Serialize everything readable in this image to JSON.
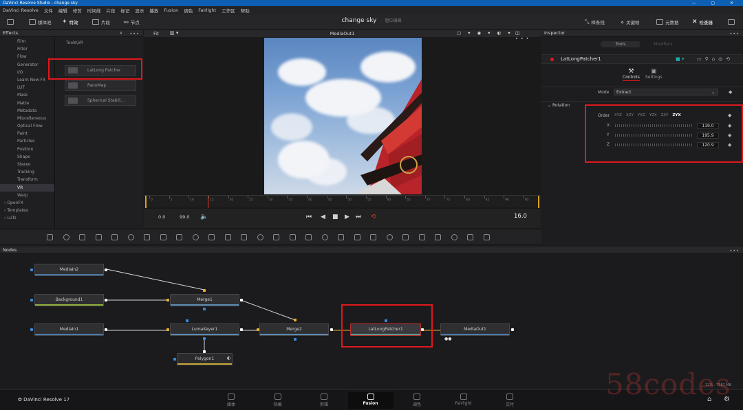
{
  "window": {
    "title": "DaVinci Resolve Studio - change sky"
  },
  "menu": [
    "DaVinci Resolve",
    "文件",
    "编辑",
    "修剪",
    "时间线",
    "片段",
    "标记",
    "显示",
    "播放",
    "Fusion",
    "调色",
    "Fairlight",
    "工作区",
    "帮助"
  ],
  "toolbar": {
    "media_pool": "媒体池",
    "effects": "特效",
    "clips": "片段",
    "nodes": "节点",
    "project_title": "change sky",
    "project_sub": "暂位编辑",
    "spline": "样条线",
    "keyframes": "关键帧",
    "metadata": "元数据",
    "inspector": "检查器"
  },
  "effects": {
    "title": "Effects",
    "tools_heading": "Tools\\VR",
    "items": [
      "Film",
      "Filter",
      "Flow",
      "Generator",
      "I/O",
      "Learn Now FX",
      "LUT",
      "Mask",
      "Matte",
      "Metadata",
      "Miscellaneous",
      "Optical Flow",
      "Paint",
      "Particles",
      "Position",
      "Shape",
      "Stereo",
      "Tracking",
      "Transform",
      "VR",
      "Warp"
    ],
    "selected": "VR",
    "groups": [
      "OpenFX",
      "Templates",
      "LUTs"
    ],
    "tools": [
      "LatLong Patcher",
      "PanoMap",
      "Spherical Stabili..."
    ]
  },
  "viewer": {
    "title": "MediaOut1",
    "zoom": "Fit",
    "start": "0.0",
    "end": "99.0",
    "current": "16.0",
    "ticks": [
      "0",
      "5",
      "10",
      "15",
      "20",
      "25",
      "30",
      "35",
      "40",
      "45",
      "50",
      "55",
      "60",
      "65",
      "70",
      "75",
      "80",
      "85",
      "90",
      "95"
    ]
  },
  "inspector": {
    "title": "Inspector",
    "tab_tools": "Tools",
    "tab_modifiers": "Modifiers",
    "node_name": "LatLongPatcher1",
    "controls": "Controls",
    "settings": "Settings",
    "mode_label": "Mode",
    "mode_value": "Extract",
    "rotation_label": "Rotation",
    "order_label": "Order",
    "orders": [
      "XYZ",
      "XZY",
      "YXZ",
      "YZX",
      "ZXY",
      "ZYX"
    ],
    "active_order": "ZYX",
    "axes": [
      {
        "label": "X",
        "value": "119.0"
      },
      {
        "label": "Y",
        "value": "195.9"
      },
      {
        "label": "Z",
        "value": "120.9"
      }
    ]
  },
  "nodes": {
    "title": "Nodes",
    "list": {
      "mediain2": "MediaIn2",
      "background1": "Background1",
      "mediain1": "MediaIn1",
      "merge1": "Merge1",
      "lumakeyer1": "LumaKeyer1",
      "polygon1": "Polygon1",
      "merge2": "Merge2",
      "latlong": "LatLongPatcher1",
      "mediaout1": "MediaOut1"
    },
    "status": "12% - 7581 MB"
  },
  "footer": {
    "app": "DaVinci Resolve 17",
    "pages": [
      "媒体",
      "快编",
      "剪辑",
      "Fusion",
      "调色",
      "Fairlight",
      "交付"
    ],
    "active": "Fusion"
  },
  "watermark": "58codes",
  "colors": {
    "accent_red": "#e0181c",
    "titlebar": "#0c5fb3",
    "node_selected_bar": "#5a9e8e"
  }
}
